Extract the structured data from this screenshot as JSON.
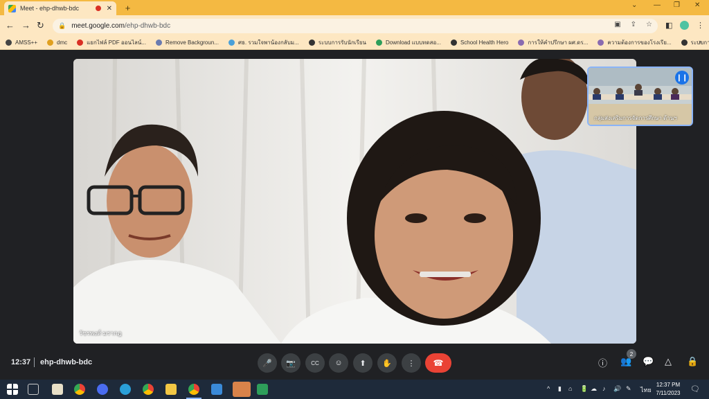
{
  "browser": {
    "tab_title": "Meet - ehp-dhwb-bdc",
    "tab_close": "✕",
    "new_tab": "+",
    "window_controls": [
      "⌄",
      "—",
      "❐",
      "✕"
    ],
    "nav": {
      "back": "←",
      "forward": "→",
      "reload": "↻"
    },
    "url_host": "meet.google.com",
    "url_path": "/ehp-dhwb-bdc",
    "omnibox_icons": [
      "▣",
      "⇪",
      "☆"
    ],
    "toolbar_right": [
      "◧",
      "⋮"
    ]
  },
  "bookmarks": [
    {
      "label": "AMSS++",
      "color": "#444"
    },
    {
      "label": "dmc",
      "color": "#e0a020"
    },
    {
      "label": "แยกไฟล์ PDF ออนไลน์...",
      "color": "#d93025"
    },
    {
      "label": "Remove Backgroun...",
      "color": "#6a7bb0"
    },
    {
      "label": "ศธ. รวมใจพาน้องกลับม...",
      "color": "#4aa0d8"
    },
    {
      "label": "ระบบการรับนักเรียน",
      "color": "#333"
    },
    {
      "label": "Download แบบทดสอ...",
      "color": "#2e9e5a"
    },
    {
      "label": "School Health Hero",
      "color": "#333"
    },
    {
      "label": "การให้คำปรึกษา ผศ.ดร...",
      "color": "#8a6bb0"
    },
    {
      "label": "ความต้องการของโรงเรีย...",
      "color": "#8a6bb0"
    },
    {
      "label": "ระบบการลงทะเบียนสำนั...",
      "color": "#333"
    }
  ],
  "bookmarks_more": "»",
  "meet": {
    "speaker_name": "วัชรพงศ์ มรากฎ",
    "pip_name": "กลุ่มส่งเสริมการจัดการศึกษา ด้านฯ",
    "clock": "12:37",
    "meeting_code": "ehp-dhwb-bdc",
    "controls": [
      "🎤",
      "📷",
      "CC",
      "☺",
      "⬆",
      "✋",
      "⋮"
    ],
    "hangup": "☎",
    "right_controls": [
      "ⓘ",
      "👥",
      "💬",
      "△"
    ],
    "participant_count": "2"
  },
  "taskbar": {
    "time": "12:37 PM",
    "date": "7/11/2023",
    "lang": "ไทย",
    "tray_icons": [
      "^",
      "▮",
      "⌂",
      "🔋",
      "☁",
      "♪",
      "🔊"
    ]
  },
  "colors": {
    "accent": "#f4b942",
    "meet_bg": "#202124",
    "hangup": "#ea4335"
  }
}
